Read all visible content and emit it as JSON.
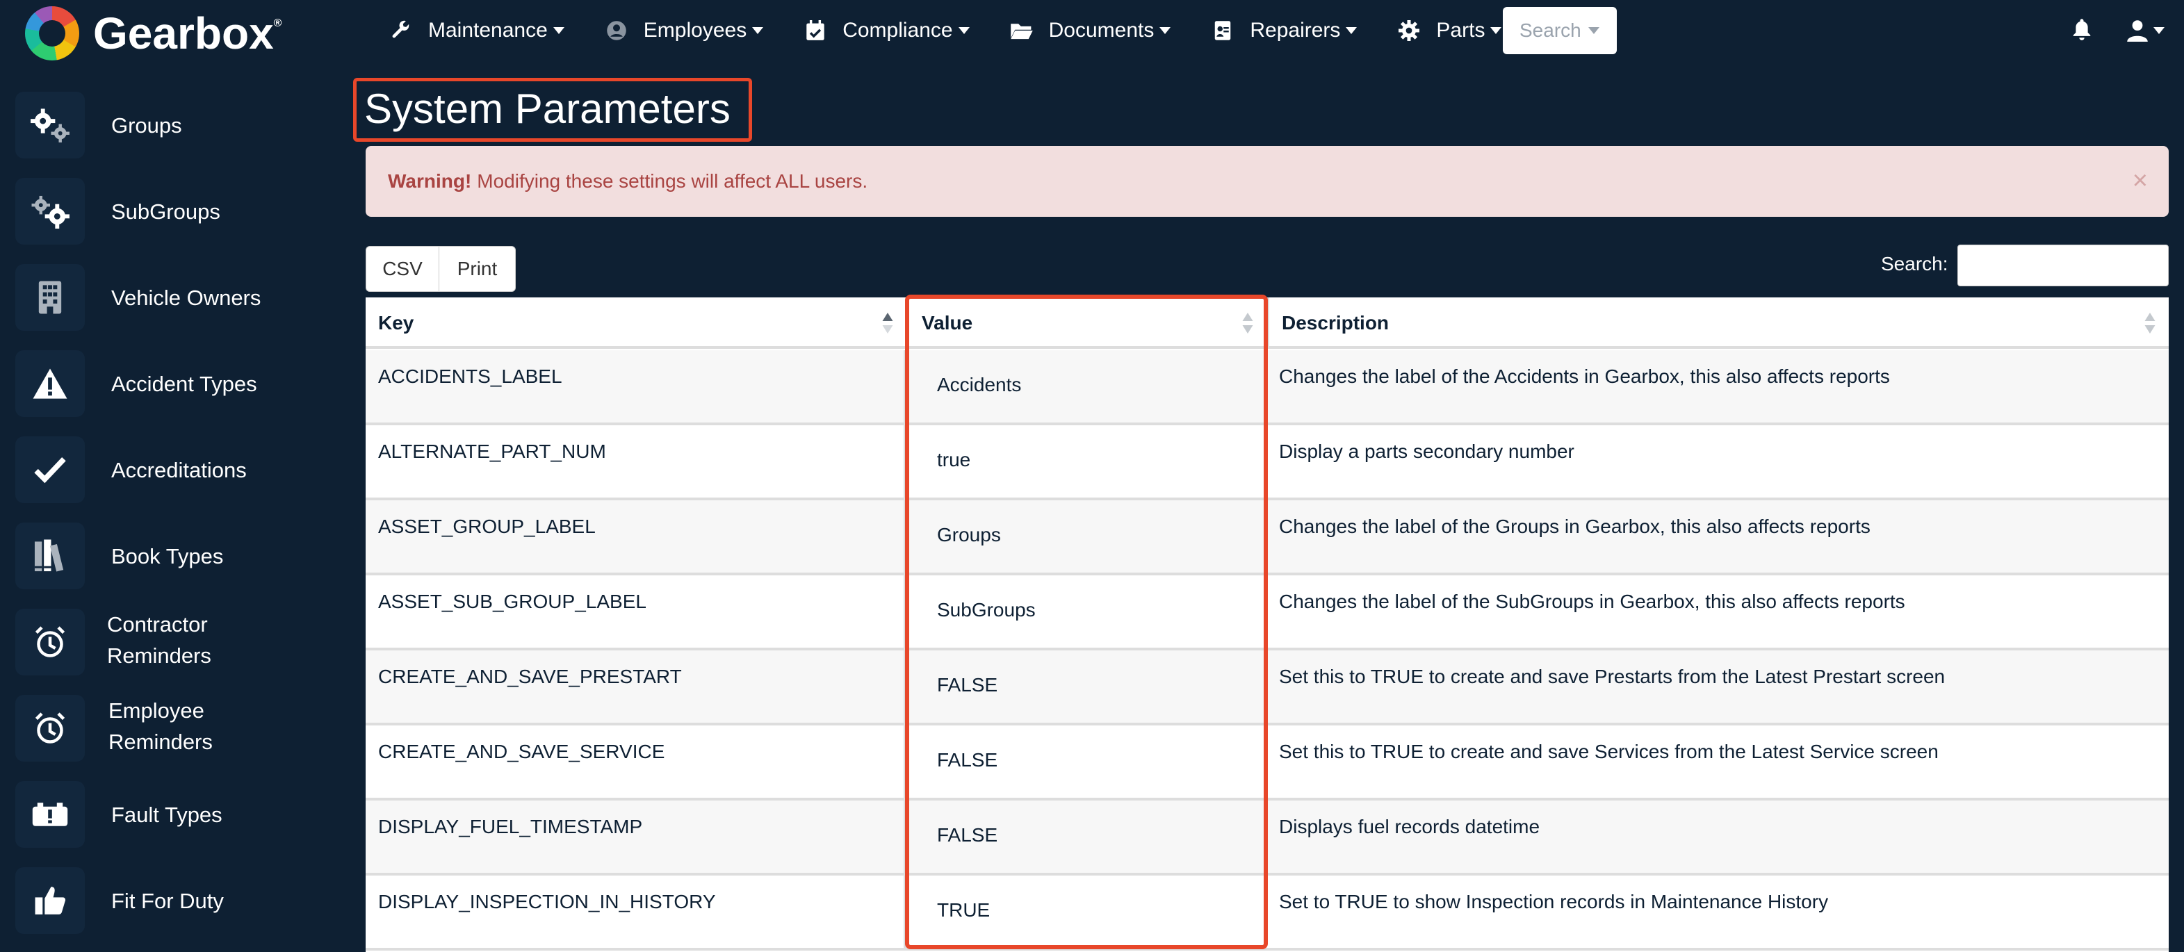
{
  "app": {
    "logo_text": "Gearbox",
    "trademark": "®"
  },
  "nav": {
    "items": [
      {
        "label": "Maintenance",
        "icon": "wrench-icon"
      },
      {
        "label": "Employees",
        "icon": "user-circle-icon"
      },
      {
        "label": "Compliance",
        "icon": "calendar-check-icon"
      },
      {
        "label": "Documents",
        "icon": "folder-open-icon"
      },
      {
        "label": "Repairers",
        "icon": "id-card-icon"
      },
      {
        "label": "Parts",
        "icon": "gear-icon"
      }
    ],
    "search_label": "Search"
  },
  "sidebar": {
    "items": [
      {
        "label": "Groups",
        "icon": "cogs-icon"
      },
      {
        "label": "SubGroups",
        "icon": "cogs-icon"
      },
      {
        "label": "Vehicle Owners",
        "icon": "building-icon"
      },
      {
        "label": "Accident Types",
        "icon": "warning-icon"
      },
      {
        "label": "Accreditations",
        "icon": "check-icon"
      },
      {
        "label": "Book Types",
        "icon": "books-icon"
      },
      {
        "label_line1": "Contractor",
        "label_line2": "Reminders",
        "icon": "alarm-clock-icon"
      },
      {
        "label_line1": "Employee",
        "label_line2": "Reminders",
        "icon": "alarm-clock-icon"
      },
      {
        "label": "Fault Types",
        "icon": "car-battery-alert-icon"
      },
      {
        "label": "Fit For Duty",
        "icon": "thumbs-up-icon"
      }
    ]
  },
  "page": {
    "title": "System Parameters"
  },
  "alert": {
    "strong": "Warning!",
    "text": "Modifying these settings will affect ALL users.",
    "close": "×"
  },
  "toolbar": {
    "csv_label": "CSV",
    "print_label": "Print",
    "search_label": "Search:"
  },
  "table": {
    "headers": {
      "key": "Key",
      "value": "Value",
      "description": "Description"
    },
    "rows": [
      {
        "key": "ACCIDENTS_LABEL",
        "value": "Accidents",
        "description": "Changes the label of the Accidents in Gearbox, this also affects reports"
      },
      {
        "key": "ALTERNATE_PART_NUM",
        "value": "true",
        "description": "Display a parts secondary number"
      },
      {
        "key": "ASSET_GROUP_LABEL",
        "value": "Groups",
        "description": "Changes the label of the Groups in Gearbox, this also affects reports"
      },
      {
        "key": "ASSET_SUB_GROUP_LABEL",
        "value": "SubGroups",
        "description": "Changes the label of the SubGroups in Gearbox, this also affects reports"
      },
      {
        "key": "CREATE_AND_SAVE_PRESTART",
        "value": "FALSE",
        "description": "Set this to TRUE to create and save Prestarts from the Latest Prestart screen"
      },
      {
        "key": "CREATE_AND_SAVE_SERVICE",
        "value": "FALSE",
        "description": "Set this to TRUE to create and save Services from the Latest Service screen"
      },
      {
        "key": "DISPLAY_FUEL_TIMESTAMP",
        "value": "FALSE",
        "description": "Displays fuel records datetime"
      },
      {
        "key": "DISPLAY_INSPECTION_IN_HISTORY",
        "value": "TRUE",
        "description": "Set to TRUE to show Inspection records in Maintenance History"
      }
    ]
  },
  "colors": {
    "background": "#0e2033",
    "highlight": "#e8472a",
    "alert_bg": "#f2dede",
    "alert_text": "#a94442"
  }
}
